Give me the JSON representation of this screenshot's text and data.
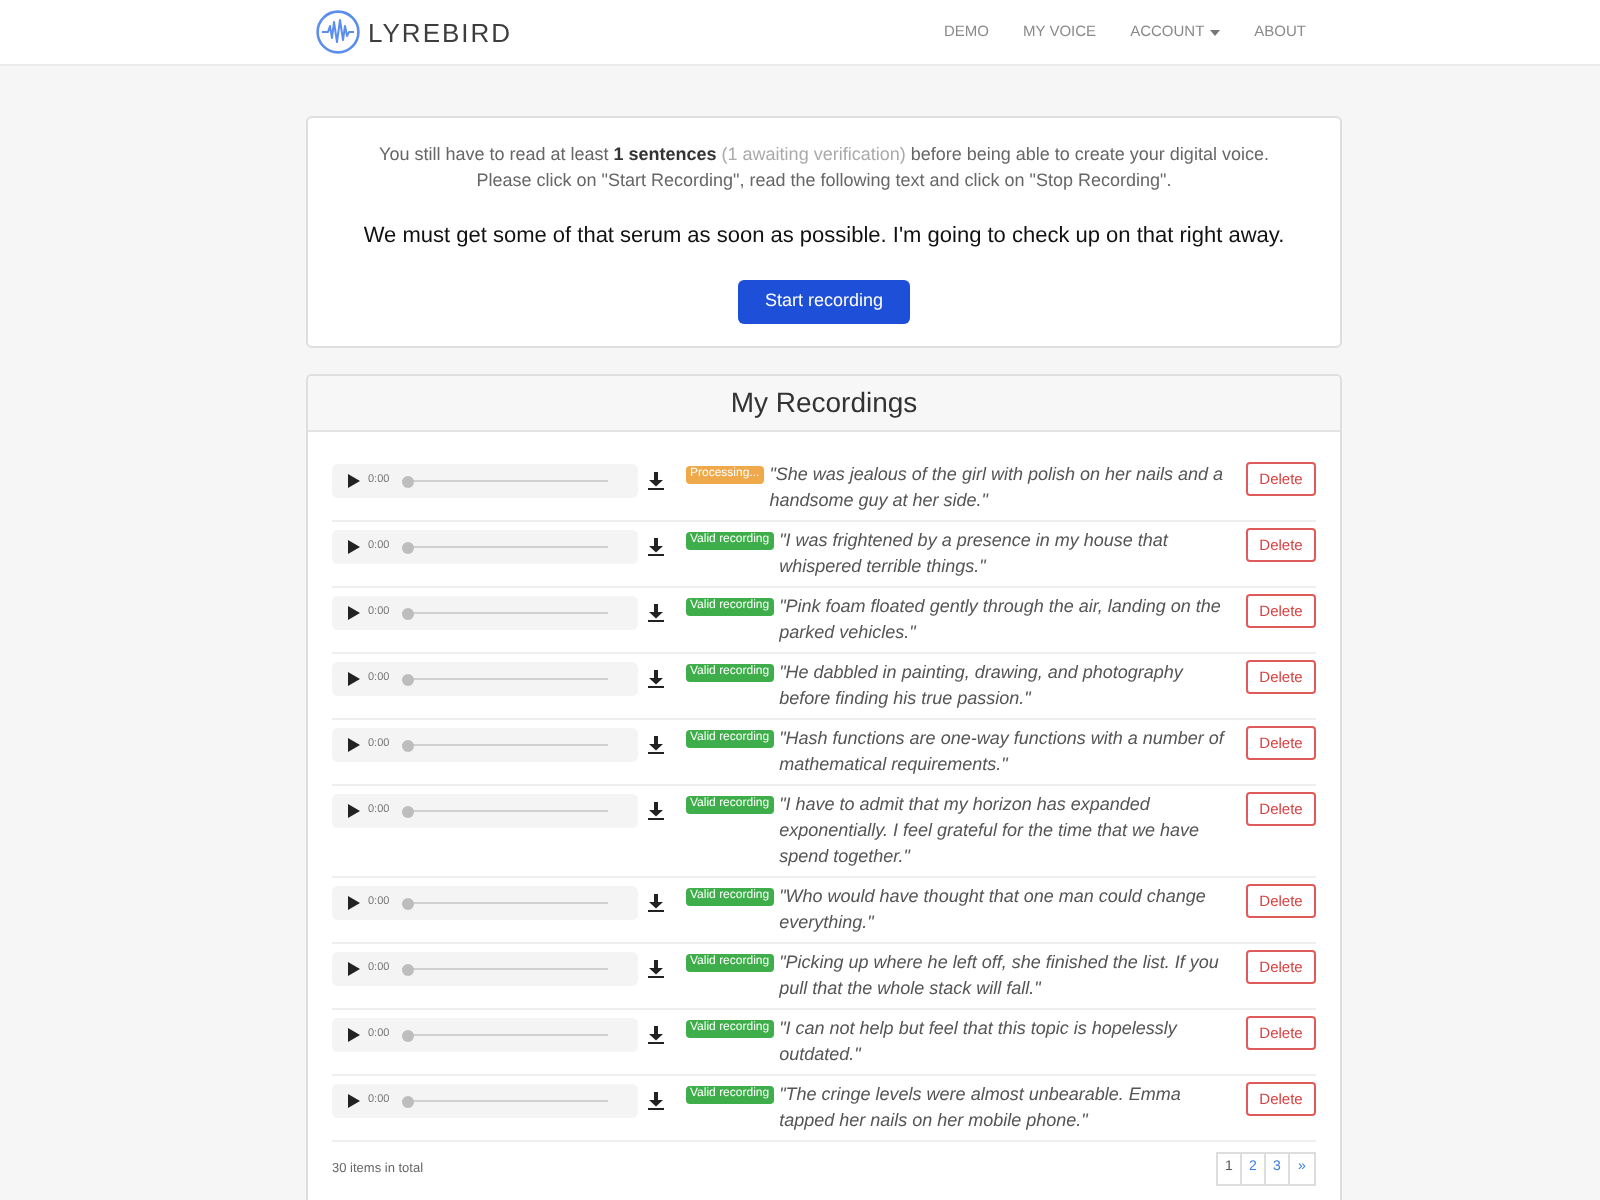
{
  "navbar": {
    "logo_text": "LYREBIRD",
    "links": [
      {
        "label": "DEMO",
        "dropdown": false
      },
      {
        "label": "MY VOICE",
        "dropdown": false
      },
      {
        "label": "ACCOUNT",
        "dropdown": true
      },
      {
        "label": "ABOUT",
        "dropdown": false
      }
    ]
  },
  "prompt_card": {
    "notice": [
      {
        "kind": "normal",
        "text": "You still have to read at least "
      },
      {
        "kind": "bold",
        "text": "1 sentences"
      },
      {
        "kind": "muted",
        "text": " (1 awaiting verification)"
      },
      {
        "kind": "normal",
        "text": " before being able to create your digital voice."
      }
    ],
    "instructions": "Please click on \"Start Recording\", read the following text and click on \"Stop Recording\".",
    "sentence": "We must get some of that serum as soon as possible. I'm going to check up on that right away.",
    "button": "Start recording"
  },
  "recordings": {
    "title": "My Recordings",
    "items": [
      {
        "time": "0:00",
        "level": 0,
        "status": {
          "kind": "processing",
          "label": "Processing..."
        },
        "text": "\"She was jealous of the girl with polish on her nails and a handsome guy at her side.\"",
        "action": "Delete"
      },
      {
        "time": "0:00",
        "level": 0,
        "status": {
          "kind": "valid",
          "label": "Valid recording"
        },
        "text": "\"I was frightened by a presence in my house that whispered terrible things.\"",
        "action": "Delete"
      },
      {
        "time": "0:00",
        "level": 0,
        "status": {
          "kind": "valid",
          "label": "Valid recording"
        },
        "text": "\"Pink foam floated gently through the air, landing on the parked vehicles.\"",
        "action": "Delete"
      },
      {
        "time": "0:00",
        "level": 0,
        "status": {
          "kind": "valid",
          "label": "Valid recording"
        },
        "text": "\"He dabbled in painting, drawing, and photography before finding his true passion.\"",
        "action": "Delete"
      },
      {
        "time": "0:00",
        "level": 0,
        "status": {
          "kind": "valid",
          "label": "Valid recording"
        },
        "text": "\"Hash functions are one-way functions with a number of mathematical requirements.\"",
        "action": "Delete"
      },
      {
        "time": "0:00",
        "level": 0,
        "status": {
          "kind": "valid",
          "label": "Valid recording"
        },
        "text": "\"I have to admit that my horizon has expanded exponentially. I feel grateful for the time that we have spend together.\"",
        "action": "Delete"
      },
      {
        "time": "0:00",
        "level": 0,
        "status": {
          "kind": "valid",
          "label": "Valid recording"
        },
        "text": "\"Who would have thought that one man could change everything.\"",
        "action": "Delete"
      },
      {
        "time": "0:00",
        "level": 0,
        "status": {
          "kind": "valid",
          "label": "Valid recording"
        },
        "text": "\"Picking up where he left off, she finished the list. If you pull that the whole stack will fall.\"",
        "action": "Delete"
      },
      {
        "time": "0:00",
        "level": 0,
        "status": {
          "kind": "valid",
          "label": "Valid recording"
        },
        "text": "\"I can not help but feel that this topic is hopelessly outdated.\"",
        "action": "Delete"
      },
      {
        "time": "0:00",
        "level": 0,
        "status": {
          "kind": "valid",
          "label": "Valid recording"
        },
        "text": "\"The cringe levels were almost unbearable. Emma tapped her nails on her mobile phone.\"",
        "action": "Delete"
      }
    ],
    "total": "30 items in total",
    "pagination": {
      "pages": [
        {
          "label": "1",
          "selected": true
        },
        {
          "label": "2",
          "selected": false
        },
        {
          "label": "3",
          "selected": false
        }
      ],
      "next": "»"
    }
  }
}
